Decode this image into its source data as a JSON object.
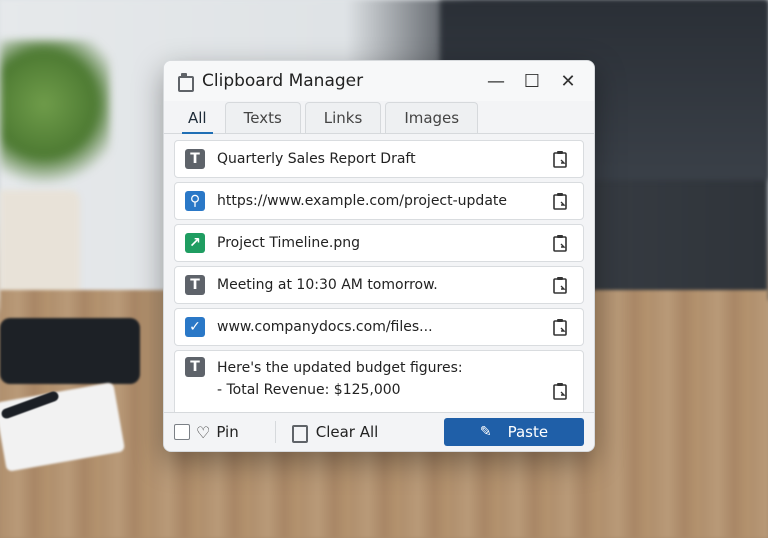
{
  "window": {
    "title": "Clipboard Manager",
    "controls": {
      "minimize": "—",
      "maximize": "☐",
      "close": "✕"
    }
  },
  "tabs": [
    {
      "label": "All",
      "active": true
    },
    {
      "label": "Texts",
      "active": false
    },
    {
      "label": "Links",
      "active": false
    },
    {
      "label": "Images",
      "active": false
    }
  ],
  "items": [
    {
      "type": "text",
      "icon": "text-icon",
      "text": "Quarterly Sales Report Draft"
    },
    {
      "type": "link",
      "icon": "link-icon",
      "text": "https://www.example.com/project-update"
    },
    {
      "type": "image",
      "icon": "image-icon",
      "text": "Project Timeline.png"
    },
    {
      "type": "text",
      "icon": "text-icon",
      "text": "Meeting at 10:30 AM tomorrow."
    },
    {
      "type": "link",
      "icon": "check-link-icon",
      "text": "www.companydocs.com/files..."
    },
    {
      "type": "text",
      "icon": "text-icon",
      "line1": "Here's the updated budget figures:",
      "line2": "- Total Revenue: $125,000"
    }
  ],
  "bottom": {
    "pin_label": "Pin",
    "clear_label": "Clear All",
    "paste_label": "Paste",
    "paste_icon": "✎",
    "pin_icon": "♡"
  },
  "icons": {
    "text_glyph": "T",
    "link_glyph": "⚲",
    "image_glyph": "↗",
    "check_glyph": "✓"
  },
  "colors": {
    "accent": "#1f5fa8",
    "tab_underline": "#1f6fb5",
    "text_icon_bg": "#5e636a",
    "link_icon_bg": "#2a78c7",
    "image_icon_bg": "#1f9d61"
  }
}
